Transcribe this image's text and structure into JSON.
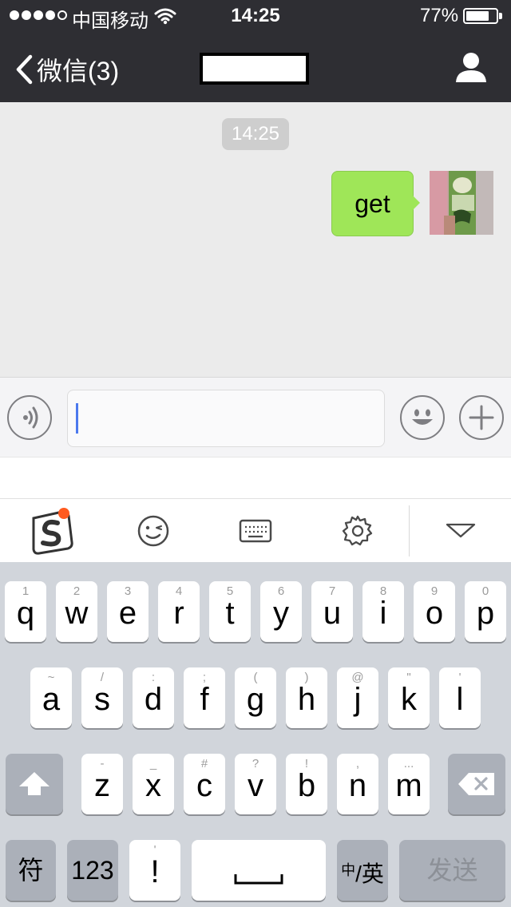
{
  "status_bar": {
    "carrier": "中国移动",
    "time": "14:25",
    "battery_pct": "77%",
    "battery_level": 0.77,
    "signal_bars_filled": 4,
    "signal_bars_total": 5
  },
  "nav": {
    "back_label": "微信(3)"
  },
  "chat": {
    "timestamp": "14:25",
    "messages": [
      {
        "text": "get",
        "sender": "me"
      }
    ]
  },
  "keyboard": {
    "row1": [
      {
        "hint": "1",
        "key": "q"
      },
      {
        "hint": "2",
        "key": "w"
      },
      {
        "hint": "3",
        "key": "e"
      },
      {
        "hint": "4",
        "key": "r"
      },
      {
        "hint": "5",
        "key": "t"
      },
      {
        "hint": "6",
        "key": "y"
      },
      {
        "hint": "7",
        "key": "u"
      },
      {
        "hint": "8",
        "key": "i"
      },
      {
        "hint": "9",
        "key": "o"
      },
      {
        "hint": "0",
        "key": "p"
      }
    ],
    "row2": [
      {
        "hint": "~",
        "key": "a"
      },
      {
        "hint": "/",
        "key": "s"
      },
      {
        "hint": ":",
        "key": "d"
      },
      {
        "hint": ";",
        "key": "f"
      },
      {
        "hint": "(",
        "key": "g"
      },
      {
        "hint": ")",
        "key": "h"
      },
      {
        "hint": "@",
        "key": "j"
      },
      {
        "hint": "\"",
        "key": "k"
      },
      {
        "hint": "'",
        "key": "l"
      }
    ],
    "row3": [
      {
        "hint": "-",
        "key": "z"
      },
      {
        "hint": "_",
        "key": "x"
      },
      {
        "hint": "#",
        "key": "c"
      },
      {
        "hint": "?",
        "key": "v"
      },
      {
        "hint": "!",
        "key": "b"
      },
      {
        "hint": ",",
        "key": "n"
      },
      {
        "hint": "...",
        "key": "m"
      }
    ],
    "fu_label": "符",
    "num_label": "123",
    "punct_label": "!",
    "punct_hint": "'",
    "lang_small": "中",
    "lang_label": "/英",
    "send_label": "发送"
  },
  "colors": {
    "header_bg": "#2e2e33",
    "chat_bg": "#ebebeb",
    "bubble_bg": "#9fe658",
    "caret": "#4c79ee",
    "keyboard_bg": "#d1d5db",
    "badge": "#ff5a1f"
  },
  "icons": {
    "voice": "voice-icon",
    "emoji": "emoji-icon",
    "plus": "plus-icon",
    "profile": "profile-icon",
    "back": "chevron-left-icon",
    "sogou": "sogou-logo-icon",
    "wink": "wink-icon",
    "keyboard": "keyboard-icon",
    "settings": "gear-icon",
    "collapse": "triangle-down-icon",
    "shift": "shift-icon",
    "delete": "delete-icon",
    "space": "space-icon"
  }
}
